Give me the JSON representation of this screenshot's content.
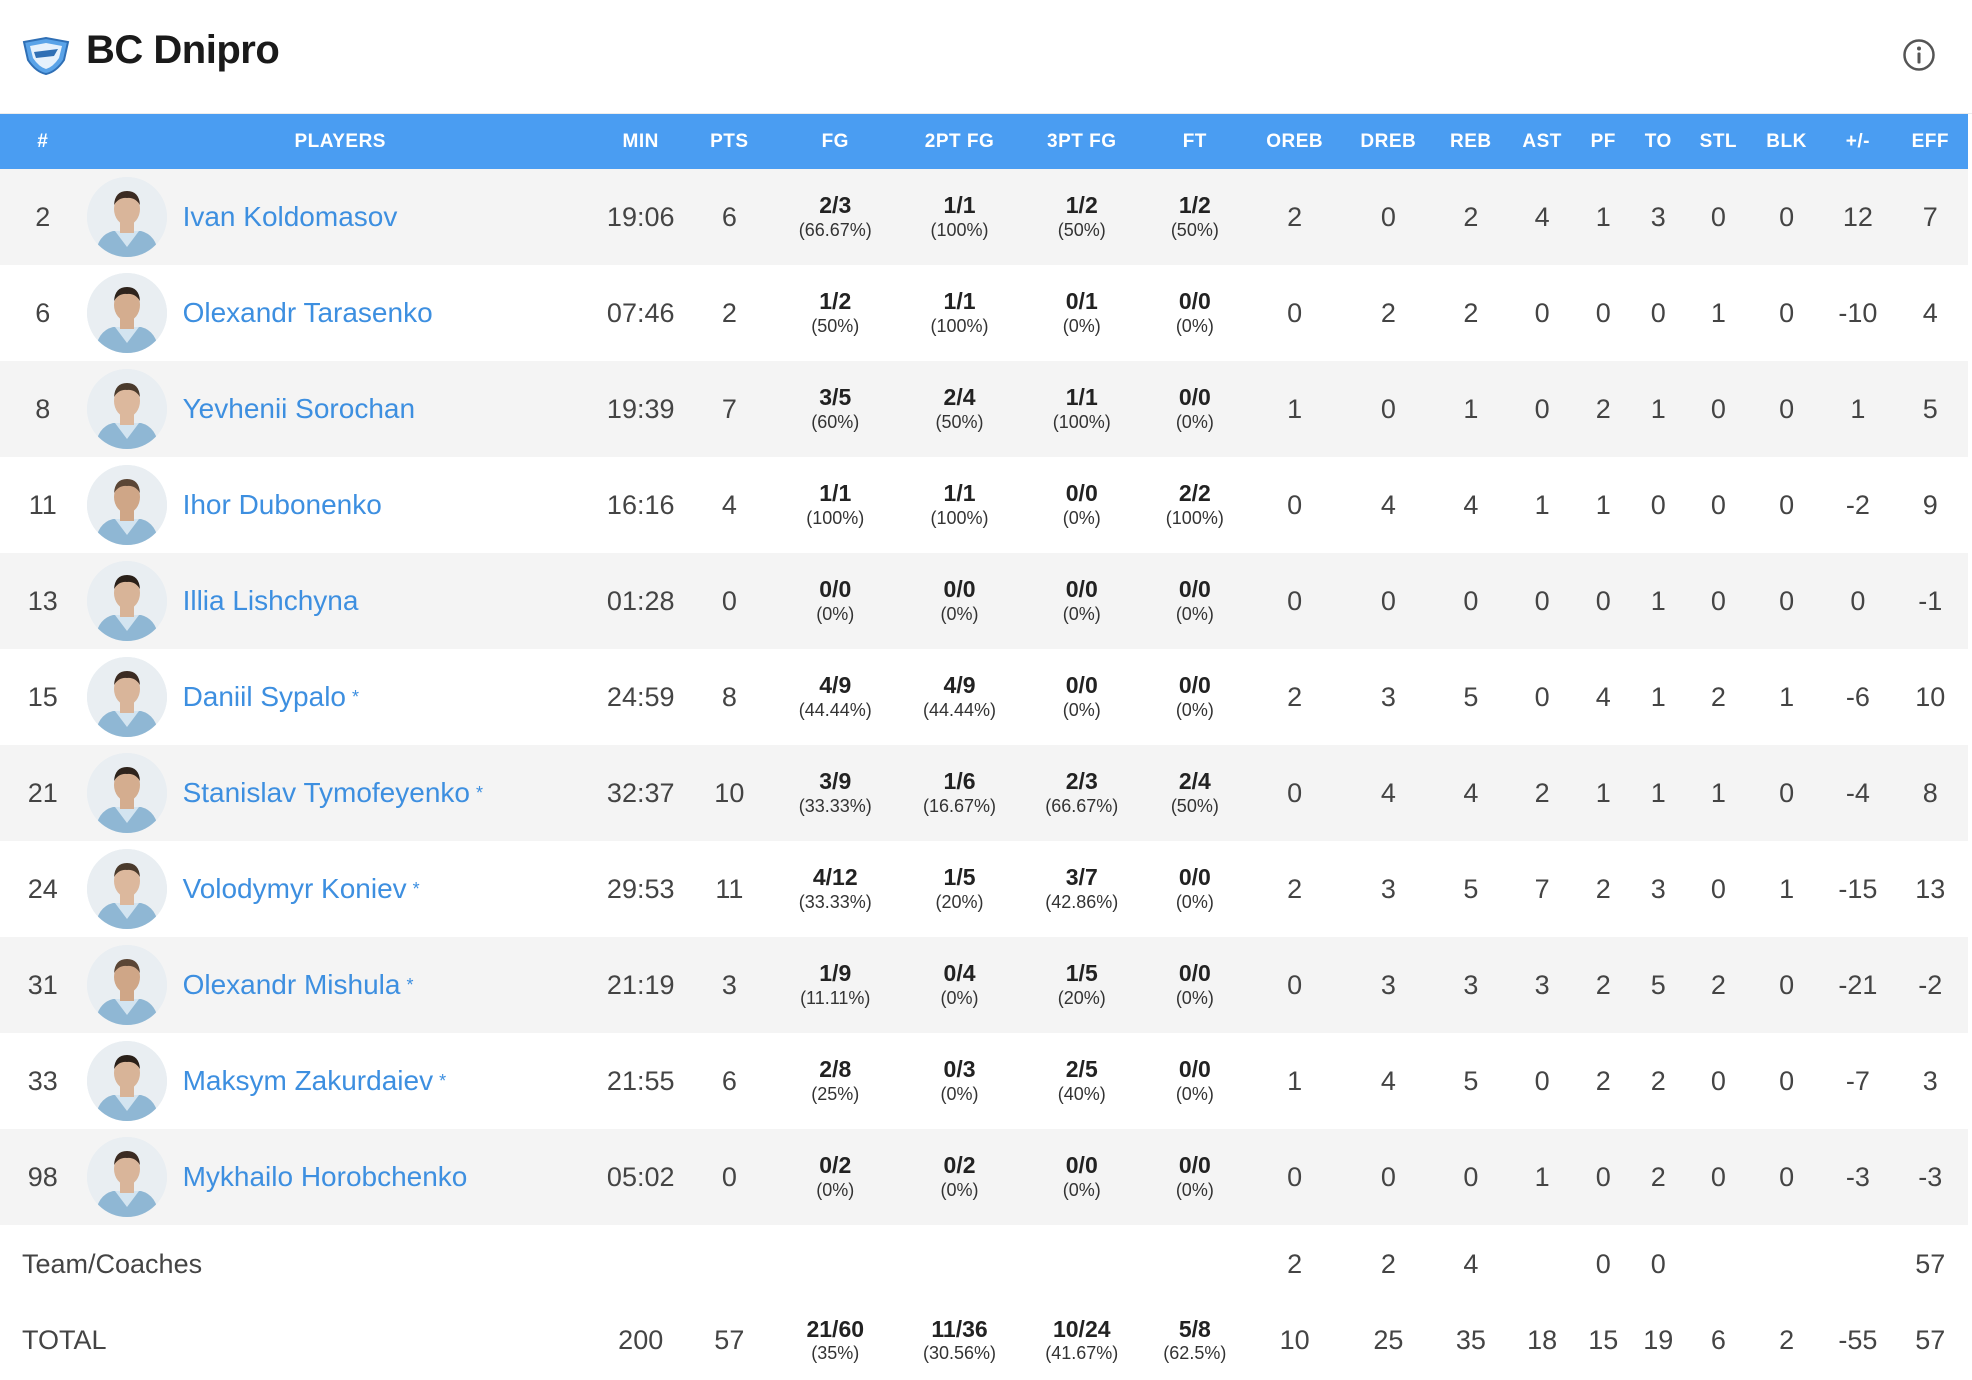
{
  "header": {
    "team_name": "BC Dnipro",
    "logo_icon": "dnipro-shield-logo",
    "info_icon": "info-circle-icon"
  },
  "colors": {
    "header_bg": "#4a9df2",
    "link": "#3d8fe0",
    "row_alt": "#f4f4f4"
  },
  "columns": [
    "#",
    "PLAYERS",
    "MIN",
    "PTS",
    "FG",
    "2PT FG",
    "3PT FG",
    "FT",
    "OREB",
    "DREB",
    "REB",
    "AST",
    "PF",
    "TO",
    "STL",
    "BLK",
    "+/-",
    "EFF"
  ],
  "players": [
    {
      "number": "2",
      "name": "Ivan Koldomasov",
      "starter": "",
      "min": "19:06",
      "pts": "6",
      "fg": "2/3",
      "fg_pct": "(66.67%)",
      "fg2": "1/1",
      "fg2_pct": "(100%)",
      "fg3": "1/2",
      "fg3_pct": "(50%)",
      "ft": "1/2",
      "ft_pct": "(50%)",
      "oreb": "2",
      "dreb": "0",
      "reb": "2",
      "ast": "4",
      "pf": "1",
      "to": "3",
      "stl": "0",
      "blk": "0",
      "pm": "12",
      "eff": "7"
    },
    {
      "number": "6",
      "name": "Olexandr Tarasenko",
      "starter": "",
      "min": "07:46",
      "pts": "2",
      "fg": "1/2",
      "fg_pct": "(50%)",
      "fg2": "1/1",
      "fg2_pct": "(100%)",
      "fg3": "0/1",
      "fg3_pct": "(0%)",
      "ft": "0/0",
      "ft_pct": "(0%)",
      "oreb": "0",
      "dreb": "2",
      "reb": "2",
      "ast": "0",
      "pf": "0",
      "to": "0",
      "stl": "1",
      "blk": "0",
      "pm": "-10",
      "eff": "4"
    },
    {
      "number": "8",
      "name": "Yevhenii Sorochan",
      "starter": "",
      "min": "19:39",
      "pts": "7",
      "fg": "3/5",
      "fg_pct": "(60%)",
      "fg2": "2/4",
      "fg2_pct": "(50%)",
      "fg3": "1/1",
      "fg3_pct": "(100%)",
      "ft": "0/0",
      "ft_pct": "(0%)",
      "oreb": "1",
      "dreb": "0",
      "reb": "1",
      "ast": "0",
      "pf": "2",
      "to": "1",
      "stl": "0",
      "blk": "0",
      "pm": "1",
      "eff": "5"
    },
    {
      "number": "11",
      "name": "Ihor Dubonenko",
      "starter": "",
      "min": "16:16",
      "pts": "4",
      "fg": "1/1",
      "fg_pct": "(100%)",
      "fg2": "1/1",
      "fg2_pct": "(100%)",
      "fg3": "0/0",
      "fg3_pct": "(0%)",
      "ft": "2/2",
      "ft_pct": "(100%)",
      "oreb": "0",
      "dreb": "4",
      "reb": "4",
      "ast": "1",
      "pf": "1",
      "to": "0",
      "stl": "0",
      "blk": "0",
      "pm": "-2",
      "eff": "9"
    },
    {
      "number": "13",
      "name": "Illia Lishchyna",
      "starter": "",
      "min": "01:28",
      "pts": "0",
      "fg": "0/0",
      "fg_pct": "(0%)",
      "fg2": "0/0",
      "fg2_pct": "(0%)",
      "fg3": "0/0",
      "fg3_pct": "(0%)",
      "ft": "0/0",
      "ft_pct": "(0%)",
      "oreb": "0",
      "dreb": "0",
      "reb": "0",
      "ast": "0",
      "pf": "0",
      "to": "1",
      "stl": "0",
      "blk": "0",
      "pm": "0",
      "eff": "-1"
    },
    {
      "number": "15",
      "name": "Daniil Sypalo",
      "starter": "*",
      "min": "24:59",
      "pts": "8",
      "fg": "4/9",
      "fg_pct": "(44.44%)",
      "fg2": "4/9",
      "fg2_pct": "(44.44%)",
      "fg3": "0/0",
      "fg3_pct": "(0%)",
      "ft": "0/0",
      "ft_pct": "(0%)",
      "oreb": "2",
      "dreb": "3",
      "reb": "5",
      "ast": "0",
      "pf": "4",
      "to": "1",
      "stl": "2",
      "blk": "1",
      "pm": "-6",
      "eff": "10"
    },
    {
      "number": "21",
      "name": "Stanislav Tymofeyenko",
      "starter": "*",
      "min": "32:37",
      "pts": "10",
      "fg": "3/9",
      "fg_pct": "(33.33%)",
      "fg2": "1/6",
      "fg2_pct": "(16.67%)",
      "fg3": "2/3",
      "fg3_pct": "(66.67%)",
      "ft": "2/4",
      "ft_pct": "(50%)",
      "oreb": "0",
      "dreb": "4",
      "reb": "4",
      "ast": "2",
      "pf": "1",
      "to": "1",
      "stl": "1",
      "blk": "0",
      "pm": "-4",
      "eff": "8"
    },
    {
      "number": "24",
      "name": "Volodymyr Koniev",
      "starter": "*",
      "min": "29:53",
      "pts": "11",
      "fg": "4/12",
      "fg_pct": "(33.33%)",
      "fg2": "1/5",
      "fg2_pct": "(20%)",
      "fg3": "3/7",
      "fg3_pct": "(42.86%)",
      "ft": "0/0",
      "ft_pct": "(0%)",
      "oreb": "2",
      "dreb": "3",
      "reb": "5",
      "ast": "7",
      "pf": "2",
      "to": "3",
      "stl": "0",
      "blk": "1",
      "pm": "-15",
      "eff": "13"
    },
    {
      "number": "31",
      "name": "Olexandr Mishula",
      "starter": "*",
      "min": "21:19",
      "pts": "3",
      "fg": "1/9",
      "fg_pct": "(11.11%)",
      "fg2": "0/4",
      "fg2_pct": "(0%)",
      "fg3": "1/5",
      "fg3_pct": "(20%)",
      "ft": "0/0",
      "ft_pct": "(0%)",
      "oreb": "0",
      "dreb": "3",
      "reb": "3",
      "ast": "3",
      "pf": "2",
      "to": "5",
      "stl": "2",
      "blk": "0",
      "pm": "-21",
      "eff": "-2"
    },
    {
      "number": "33",
      "name": "Maksym Zakurdaiev",
      "starter": "*",
      "min": "21:55",
      "pts": "6",
      "fg": "2/8",
      "fg_pct": "(25%)",
      "fg2": "0/3",
      "fg2_pct": "(0%)",
      "fg3": "2/5",
      "fg3_pct": "(40%)",
      "ft": "0/0",
      "ft_pct": "(0%)",
      "oreb": "1",
      "dreb": "4",
      "reb": "5",
      "ast": "0",
      "pf": "2",
      "to": "2",
      "stl": "0",
      "blk": "0",
      "pm": "-7",
      "eff": "3"
    },
    {
      "number": "98",
      "name": "Mykhailo Horobchenko",
      "starter": "",
      "min": "05:02",
      "pts": "0",
      "fg": "0/2",
      "fg_pct": "(0%)",
      "fg2": "0/2",
      "fg2_pct": "(0%)",
      "fg3": "0/0",
      "fg3_pct": "(0%)",
      "ft": "0/0",
      "ft_pct": "(0%)",
      "oreb": "0",
      "dreb": "0",
      "reb": "0",
      "ast": "1",
      "pf": "0",
      "to": "2",
      "stl": "0",
      "blk": "0",
      "pm": "-3",
      "eff": "-3"
    }
  ],
  "team_coaches": {
    "label": "Team/Coaches",
    "oreb": "2",
    "dreb": "2",
    "reb": "4",
    "pf": "0",
    "to": "0",
    "eff": "57"
  },
  "total": {
    "label": "TOTAL",
    "min": "200",
    "pts": "57",
    "fg": "21/60",
    "fg_pct": "(35%)",
    "fg2": "11/36",
    "fg2_pct": "(30.56%)",
    "fg3": "10/24",
    "fg3_pct": "(41.67%)",
    "ft": "5/8",
    "ft_pct": "(62.5%)",
    "oreb": "10",
    "dreb": "25",
    "reb": "35",
    "ast": "18",
    "pf": "15",
    "to": "19",
    "stl": "6",
    "blk": "2",
    "pm": "-55",
    "eff": "57"
  }
}
